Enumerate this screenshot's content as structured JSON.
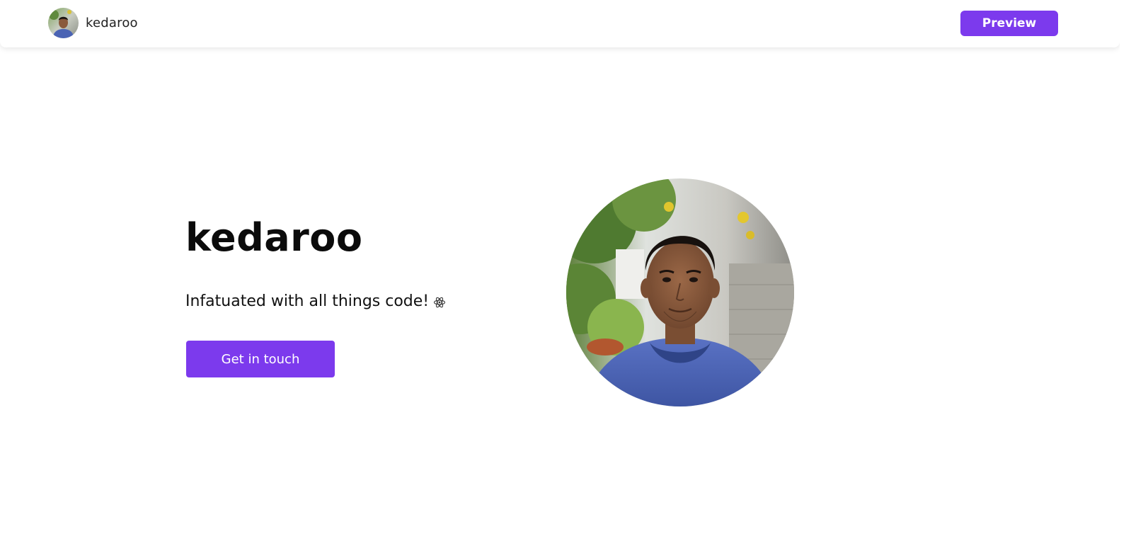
{
  "header": {
    "brand_name": "kedaroo",
    "avatar_alt": "profile photo",
    "preview_label": "Preview"
  },
  "hero": {
    "title": "kedaroo",
    "tagline": "Infatuated with all things code!",
    "tagline_icon": "react-atom-icon",
    "cta_label": "Get in touch",
    "photo_alt": "portrait photo"
  },
  "colors": {
    "accent": "#7c3aed",
    "background": "#ffffff",
    "text": "#111111"
  }
}
